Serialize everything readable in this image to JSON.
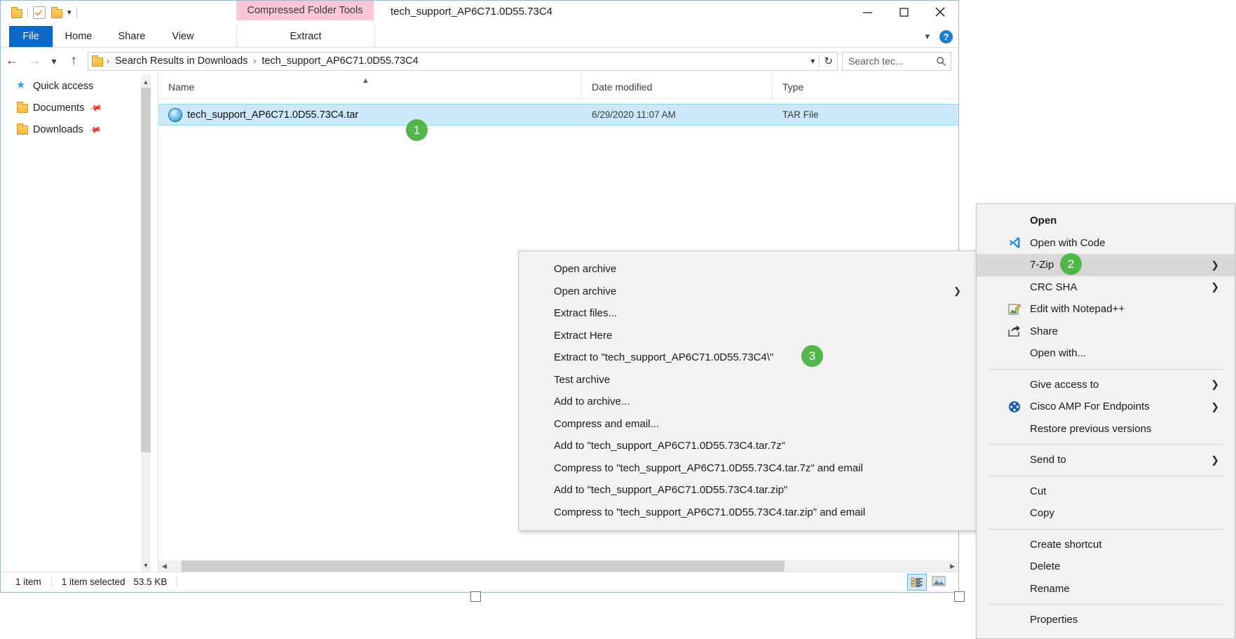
{
  "window": {
    "title": "tech_support_AP6C71.0D55.73C4",
    "contextual_tab_group": "Compressed Folder Tools",
    "minimize_label": "Minimize",
    "maximize_label": "Maximize",
    "close_label": "Close"
  },
  "ribbon": {
    "tabs": [
      {
        "label": "File",
        "id": "file"
      },
      {
        "label": "Home",
        "id": "home"
      },
      {
        "label": "Share",
        "id": "share"
      },
      {
        "label": "View",
        "id": "view"
      },
      {
        "label": "Extract",
        "id": "extract"
      }
    ],
    "help_label": "?"
  },
  "address": {
    "breadcrumbs": [
      "Search Results in Downloads",
      "tech_support_AP6C71.0D55.73C4"
    ],
    "separator": "›",
    "search_placeholder": "Search tec...",
    "refresh_label": "Refresh",
    "back_label": "Back",
    "forward_label": "Forward",
    "recent_label": "Recent locations",
    "up_label": "Up"
  },
  "nav_pane": {
    "items": [
      {
        "label": "Quick access",
        "icon": "star-icon",
        "pinned": false
      },
      {
        "label": "Documents",
        "icon": "documents-folder-icon",
        "pinned": true
      },
      {
        "label": "Downloads",
        "icon": "downloads-folder-icon",
        "pinned": true
      }
    ]
  },
  "file_list": {
    "columns": [
      "Name",
      "Date modified",
      "Type"
    ],
    "rows": [
      {
        "name": "tech_support_AP6C71.0D55.73C4.tar",
        "date_modified": "6/29/2020 11:07 AM",
        "type": "TAR File",
        "icon": "ie-archive-icon",
        "selected": true
      }
    ]
  },
  "status_bar": {
    "item_count": "1 item",
    "selection": "1 item selected",
    "size": "53.5 KB",
    "view_details_label": "Details view",
    "view_thumbnails_label": "Large icons view"
  },
  "context_menu": {
    "items": [
      {
        "label": "Open",
        "bold": true,
        "icon": null,
        "submenu": false,
        "highlighted": false
      },
      {
        "label": "Open with Code",
        "bold": false,
        "icon": "vscode-icon",
        "submenu": false,
        "highlighted": false
      },
      {
        "label": "7-Zip",
        "bold": false,
        "icon": null,
        "submenu": true,
        "highlighted": true
      },
      {
        "label": "CRC SHA",
        "bold": false,
        "icon": null,
        "submenu": true,
        "highlighted": false
      },
      {
        "label": "Edit with Notepad++",
        "bold": false,
        "icon": "notepadpp-icon",
        "submenu": false,
        "highlighted": false
      },
      {
        "label": "Share",
        "bold": false,
        "icon": "share-icon",
        "submenu": false,
        "highlighted": false
      },
      {
        "label": "Open with...",
        "bold": false,
        "icon": null,
        "submenu": false,
        "highlighted": false
      },
      {
        "separator": true
      },
      {
        "label": "Give access to",
        "bold": false,
        "icon": null,
        "submenu": true,
        "highlighted": false
      },
      {
        "label": "Cisco AMP For Endpoints",
        "bold": false,
        "icon": "cisco-amp-icon",
        "submenu": true,
        "highlighted": false
      },
      {
        "label": "Restore previous versions",
        "bold": false,
        "icon": null,
        "submenu": false,
        "highlighted": false
      },
      {
        "separator": true
      },
      {
        "label": "Send to",
        "bold": false,
        "icon": null,
        "submenu": true,
        "highlighted": false
      },
      {
        "separator": true
      },
      {
        "label": "Cut",
        "bold": false,
        "icon": null,
        "submenu": false,
        "highlighted": false
      },
      {
        "label": "Copy",
        "bold": false,
        "icon": null,
        "submenu": false,
        "highlighted": false
      },
      {
        "separator": true
      },
      {
        "label": "Create shortcut",
        "bold": false,
        "icon": null,
        "submenu": false,
        "highlighted": false
      },
      {
        "label": "Delete",
        "bold": false,
        "icon": null,
        "submenu": false,
        "highlighted": false
      },
      {
        "label": "Rename",
        "bold": false,
        "icon": null,
        "submenu": false,
        "highlighted": false
      },
      {
        "separator": true
      },
      {
        "label": "Properties",
        "bold": false,
        "icon": null,
        "submenu": false,
        "highlighted": false
      }
    ]
  },
  "submenu_7zip": {
    "items": [
      {
        "label": "Open archive",
        "submenu": false
      },
      {
        "label": "Open archive",
        "submenu": true
      },
      {
        "label": "Extract files...",
        "submenu": false
      },
      {
        "label": "Extract Here",
        "submenu": false
      },
      {
        "label": "Extract to \"tech_support_AP6C71.0D55.73C4\\\"",
        "submenu": false
      },
      {
        "label": "Test archive",
        "submenu": false
      },
      {
        "label": "Add to archive...",
        "submenu": false
      },
      {
        "label": "Compress and email...",
        "submenu": false
      },
      {
        "label": "Add to \"tech_support_AP6C71.0D55.73C4.tar.7z\"",
        "submenu": false
      },
      {
        "label": "Compress to \"tech_support_AP6C71.0D55.73C4.tar.7z\" and email",
        "submenu": false
      },
      {
        "label": "Add to \"tech_support_AP6C71.0D55.73C4.tar.zip\"",
        "submenu": false
      },
      {
        "label": "Compress to \"tech_support_AP6C71.0D55.73C4.tar.zip\" and email",
        "submenu": false
      }
    ]
  },
  "annotations": {
    "badges": [
      {
        "number": "1",
        "target": "selected-file-row"
      },
      {
        "number": "2",
        "target": "context-menu-7zip"
      },
      {
        "number": "3",
        "target": "submenu-extract-to"
      }
    ],
    "badge_color": "#52b64b"
  },
  "colors": {
    "accent": "#0b68c8",
    "contextual_tab": "#fbc6d8",
    "selection": "#cde8f9",
    "badge_green": "#52b64b"
  }
}
